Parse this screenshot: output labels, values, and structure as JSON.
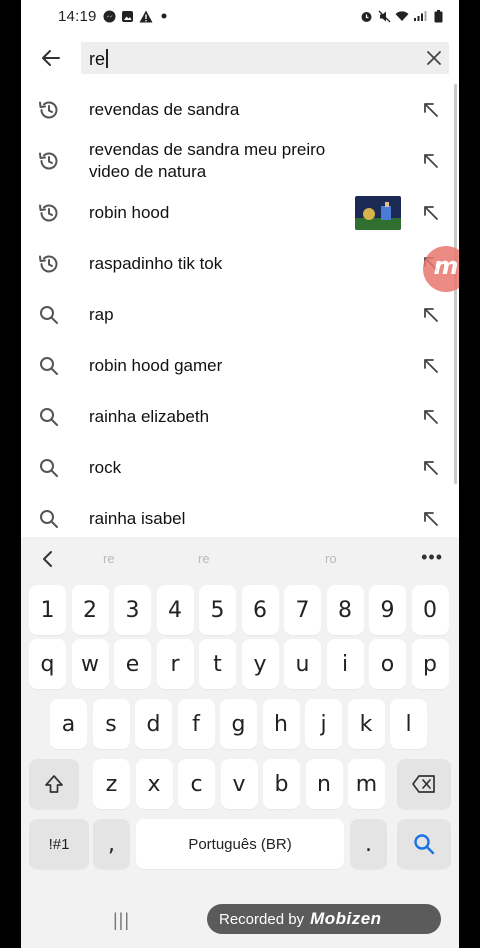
{
  "status_bar": {
    "time": "14:19"
  },
  "search": {
    "query": "re"
  },
  "suggestions": [
    {
      "type": "history",
      "text": "revendas de sandra",
      "has_thumbnail": false
    },
    {
      "type": "history",
      "text": "revendas de sandra meu preiro video de natura",
      "has_thumbnail": false
    },
    {
      "type": "history",
      "text": "robin hood",
      "has_thumbnail": true
    },
    {
      "type": "history",
      "text": "raspadinho tik tok",
      "has_thumbnail": false
    },
    {
      "type": "search",
      "text": "rap",
      "has_thumbnail": false
    },
    {
      "type": "search",
      "text": "robin hood gamer",
      "has_thumbnail": false
    },
    {
      "type": "search",
      "text": "rainha elizabeth",
      "has_thumbnail": false
    },
    {
      "type": "search",
      "text": "rock",
      "has_thumbnail": false
    },
    {
      "type": "search",
      "text": "rainha isabel",
      "has_thumbnail": false
    }
  ],
  "keyboard": {
    "suggestions": [
      "re",
      "re",
      "ro"
    ],
    "rows": [
      [
        "1",
        "2",
        "3",
        "4",
        "5",
        "6",
        "7",
        "8",
        "9",
        "0"
      ],
      [
        "q",
        "w",
        "e",
        "r",
        "t",
        "y",
        "u",
        "i",
        "o",
        "p"
      ],
      [
        "a",
        "s",
        "d",
        "f",
        "g",
        "h",
        "j",
        "k",
        "l"
      ],
      [
        "z",
        "x",
        "c",
        "v",
        "b",
        "n",
        "m"
      ]
    ],
    "symbols_key": "!#1",
    "comma_key": ",",
    "space_label": "Português (BR)",
    "period_key": "."
  },
  "overlay": {
    "recorded_label": "Recorded by",
    "brand": "Mobizen",
    "bubble_letter": "m"
  },
  "colors": {
    "accent_blue": "#1a73e8",
    "history_icon": "#606060"
  }
}
